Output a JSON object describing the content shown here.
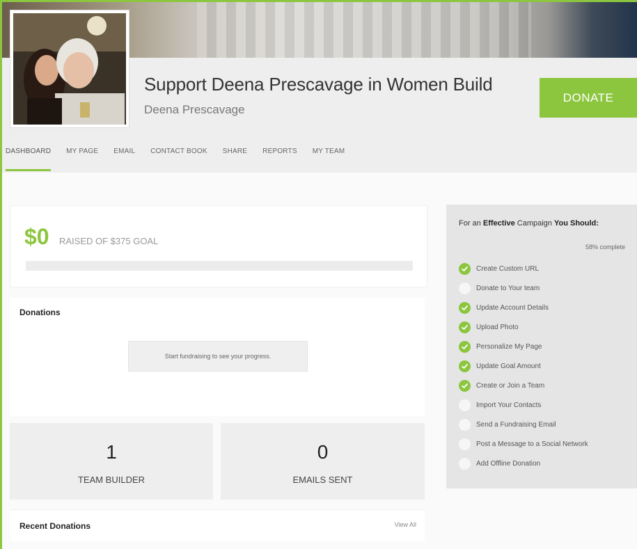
{
  "header": {
    "title": "Support Deena Prescavage in Women Build",
    "subtitle": "Deena Prescavage",
    "donate_label": "DONATE"
  },
  "nav": {
    "items": [
      "DASHBOARD",
      "MY PAGE",
      "EMAIL",
      "CONTACT BOOK",
      "SHARE",
      "REPORTS",
      "MY TEAM"
    ],
    "active": "DASHBOARD"
  },
  "raised": {
    "amount": "$0",
    "text": "RAISED OF $375 GOAL",
    "progress_fraction": 0
  },
  "donations": {
    "heading": "Donations",
    "message": "Start fundraising to see your progress."
  },
  "stats": [
    {
      "value": "1",
      "label": "TEAM BUILDER"
    },
    {
      "value": "0",
      "label": "EMAILS SENT"
    }
  ],
  "recent": {
    "heading": "Recent Donations",
    "view_all": "View All"
  },
  "checklist": {
    "title_prefix": "For an ",
    "title_bold1": "Effective",
    "title_mid": " Campaign ",
    "title_bold2": "You Should:",
    "percent_label": "58% complete",
    "items": [
      {
        "label": "Create Custom URL",
        "done": true
      },
      {
        "label": "Donate to Your team",
        "done": false
      },
      {
        "label": "Update Account Details",
        "done": true
      },
      {
        "label": "Upload Photo",
        "done": true
      },
      {
        "label": "Personalize My Page",
        "done": true
      },
      {
        "label": "Update Goal Amount",
        "done": true
      },
      {
        "label": "Create or Join a Team",
        "done": true
      },
      {
        "label": "Import Your Contacts",
        "done": false
      },
      {
        "label": "Send a Fundraising Email",
        "done": false
      },
      {
        "label": "Post a Message to a Social Network",
        "done": false
      },
      {
        "label": "Add Offline Donation",
        "done": false
      }
    ]
  },
  "colors": {
    "accent": "#8cc63f",
    "header_band": "#eeeeee",
    "stat_bg": "#eeeeee",
    "checklist_bg": "#e5e5e5"
  }
}
